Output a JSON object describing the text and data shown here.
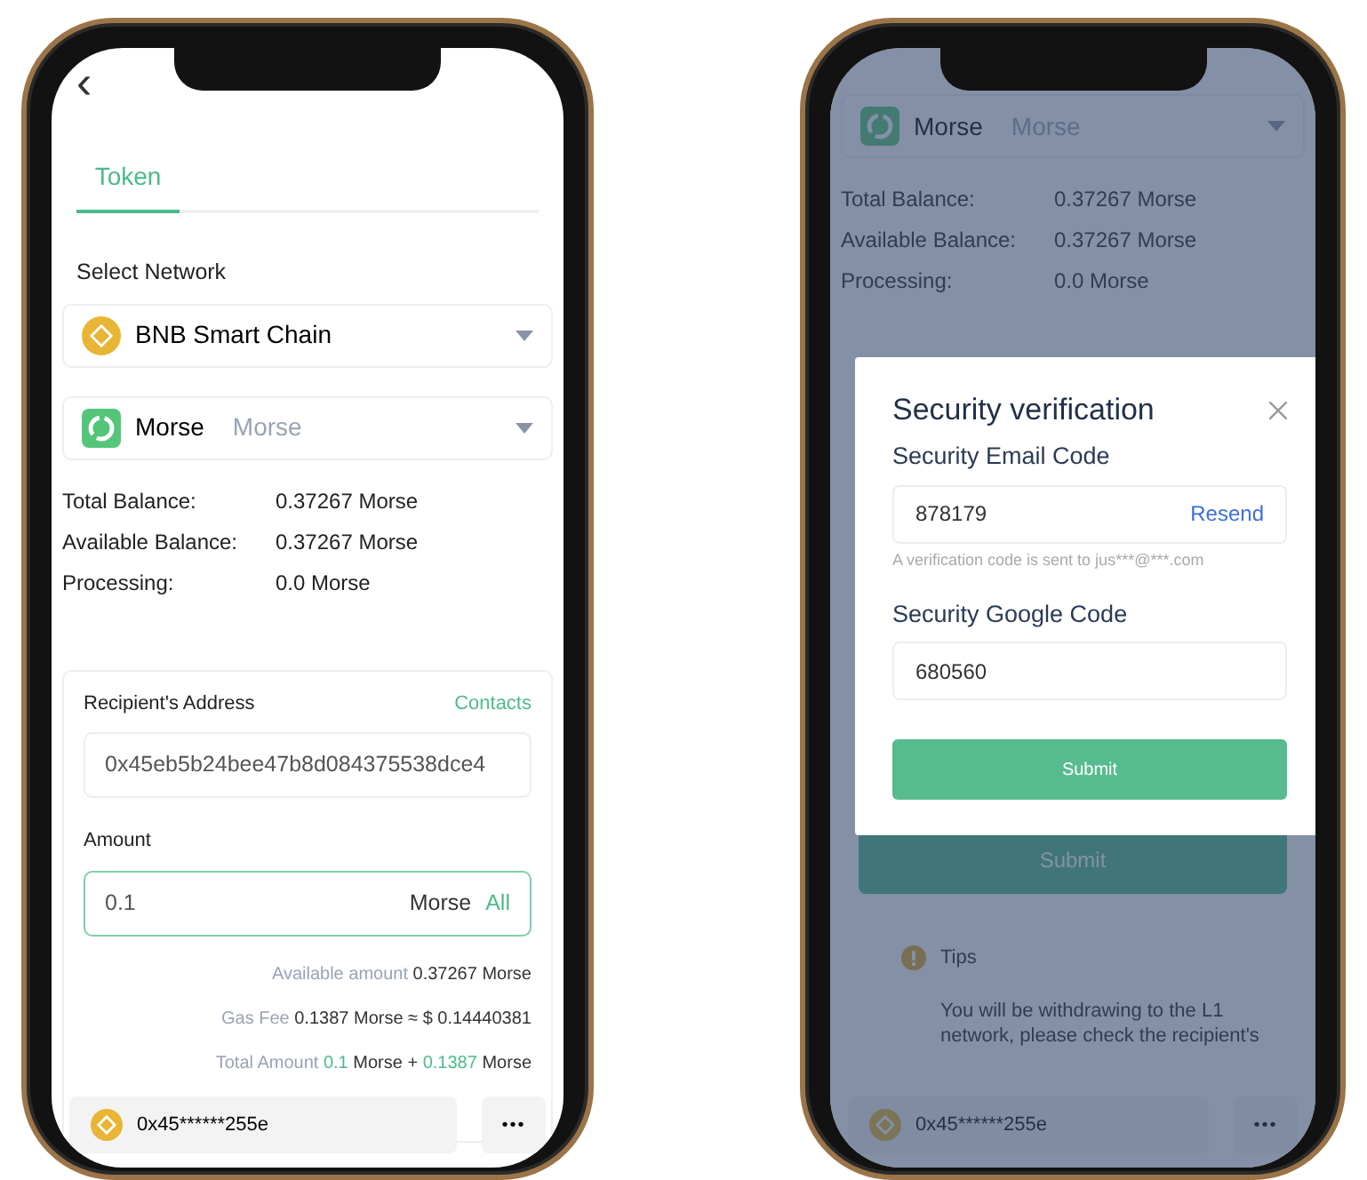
{
  "left_phone": {
    "back": "‹",
    "tabs": [
      {
        "label": "Token",
        "selected": true
      }
    ],
    "network_label": "Select Network",
    "network_select": {
      "name": "BNB Smart Chain"
    },
    "token_select": {
      "name": "Morse",
      "symbol": "Morse"
    },
    "balances": [
      {
        "label": "Total Balance:",
        "value": "0.37267 Morse"
      },
      {
        "label": "Available Balance:",
        "value": "0.37267 Morse"
      },
      {
        "label": "Processing:",
        "value": "0.0 Morse"
      }
    ],
    "form": {
      "recipient_label": "Recipient's Address",
      "contacts_link": "Contacts",
      "address_value": "0x45eb5b24bee47b8d084375538dce4",
      "amount_label": "Amount",
      "amount_value": "0.1",
      "amount_unit": "Morse",
      "all_link": "All",
      "summary": [
        [
          {
            "kind": "muted",
            "text": "Available amount"
          },
          {
            "kind": "strong",
            "text": "0.37267 Morse"
          }
        ],
        [
          {
            "kind": "muted",
            "text": "Gas Fee"
          },
          {
            "kind": "strong",
            "text": "0.1387 Morse ≈ $ 0.14440381"
          }
        ],
        [
          {
            "kind": "muted",
            "text": "Total Amount"
          },
          {
            "kind": "accent",
            "text": "0.1"
          },
          {
            "kind": "strong",
            "text": "Morse +"
          },
          {
            "kind": "accent",
            "text": "0.1387"
          },
          {
            "kind": "strong",
            "text": "Morse"
          }
        ]
      ]
    },
    "footer": {
      "wallet_address": "0x45******255e",
      "more": "•••"
    }
  },
  "right_phone": {
    "token_select": {
      "name": "Morse",
      "symbol": "Morse"
    },
    "balances": [
      {
        "label": "Total Balance:",
        "value": "0.37267 Morse"
      },
      {
        "label": "Available Balance:",
        "value": "0.37267 Morse"
      },
      {
        "label": "Processing:",
        "value": "0.0 Morse"
      }
    ],
    "submit_button": "Submit",
    "tips": {
      "title": "Tips",
      "lines": [
        "You will be withdrawing to the L1",
        "network, please check the recipient's"
      ]
    },
    "footer": {
      "wallet_address": "0x45******255e",
      "more": "•••"
    },
    "modal": {
      "title": "Security verification",
      "fields": [
        {
          "label": "Security Email Code",
          "value": "878179",
          "action": "Resend",
          "hint": "A verification code is sent to jus***@***.com"
        },
        {
          "label": "Security Google Code",
          "value": "680560"
        }
      ],
      "submit": "Submit"
    }
  }
}
